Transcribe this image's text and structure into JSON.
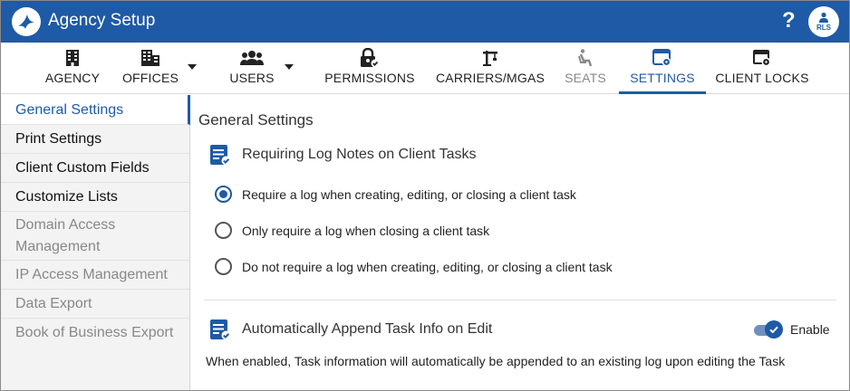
{
  "header": {
    "title": "Agency Setup",
    "help_icon": "?",
    "avatar_initials": "RLS",
    "brand_color": "#1f5aa6"
  },
  "nav": {
    "tabs": [
      {
        "label": "AGENCY",
        "icon": "building-grid-icon",
        "state": "normal"
      },
      {
        "label": "OFFICES",
        "icon": "office-building-icon",
        "state": "normal",
        "dropdown": true
      },
      {
        "label": "USERS",
        "icon": "users-icon",
        "state": "normal",
        "dropdown": true
      },
      {
        "label": "PERMISSIONS",
        "icon": "lock-check-icon",
        "state": "normal"
      },
      {
        "label": "CARRIERS/MGAS",
        "icon": "crane-icon",
        "state": "normal"
      },
      {
        "label": "SEATS",
        "icon": "seat-icon",
        "state": "disabled"
      },
      {
        "label": "SETTINGS",
        "icon": "settings-window-icon",
        "state": "active"
      },
      {
        "label": "CLIENT LOCKS",
        "icon": "client-lock-icon",
        "state": "normal"
      }
    ]
  },
  "sidebar": {
    "items": [
      {
        "label": "General Settings",
        "state": "active"
      },
      {
        "label": "Print Settings",
        "state": "normal"
      },
      {
        "label": "Client Custom Fields",
        "state": "normal"
      },
      {
        "label": "Customize Lists",
        "state": "normal"
      },
      {
        "label": "Domain Access Management",
        "state": "disabled"
      },
      {
        "label": "IP Access Management",
        "state": "disabled"
      },
      {
        "label": "Data Export",
        "state": "disabled"
      },
      {
        "label": "Book of Business Export",
        "state": "disabled"
      }
    ]
  },
  "main": {
    "page_title": "General Settings",
    "log_notes": {
      "title": "Requiring Log Notes on Client Tasks",
      "options": [
        {
          "label": "Require a log when creating, editing, or closing a client task",
          "checked": true
        },
        {
          "label": "Only require a log when closing a client task",
          "checked": false
        },
        {
          "label": "Do not require a log when creating, editing, or closing a client task",
          "checked": false
        }
      ]
    },
    "append_task": {
      "title": "Automatically Append Task Info on Edit",
      "toggle_label": "Enable",
      "toggle_on": true,
      "helper": "When enabled, Task information will automatically be appended to an existing log upon editing the Task"
    }
  }
}
